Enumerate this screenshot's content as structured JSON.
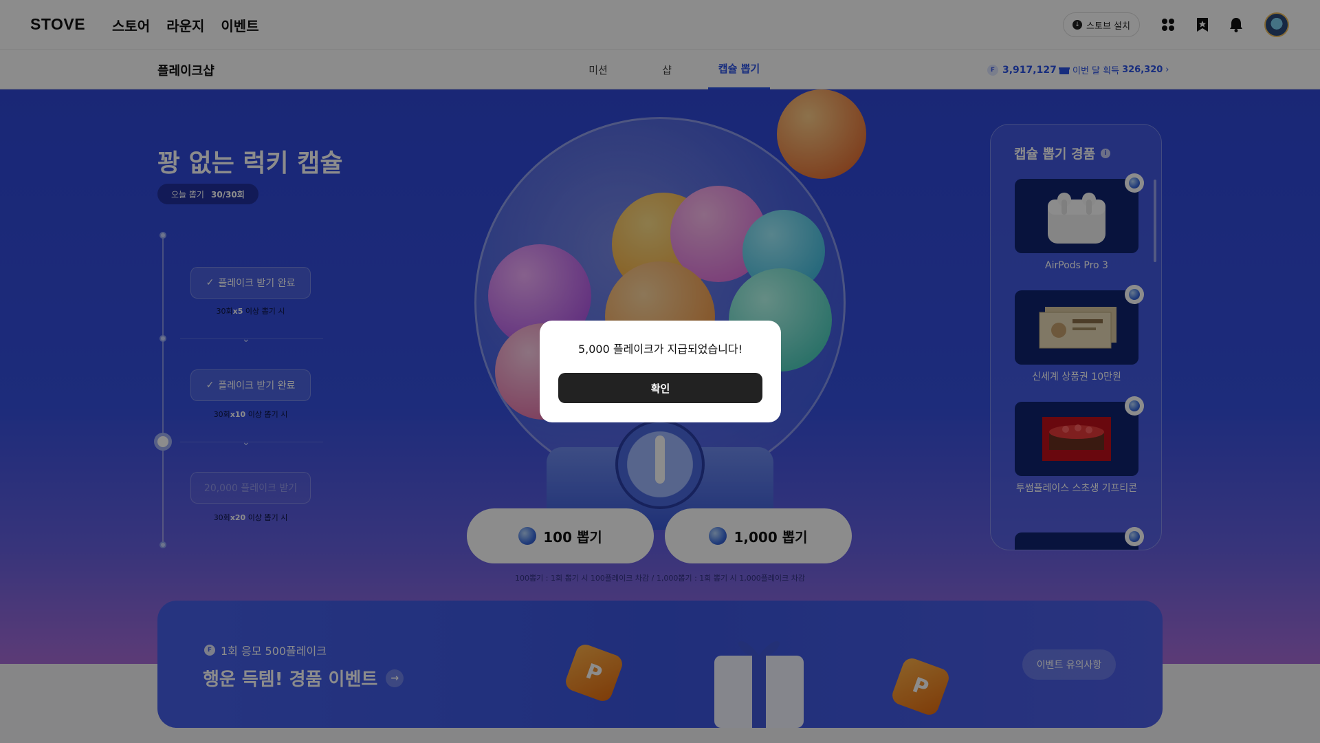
{
  "topnav": {
    "logo": "STOVE",
    "menu": [
      "스토어",
      "라운지",
      "이벤트"
    ],
    "install_label": "스토브 설치",
    "icons": [
      "apps-grid-icon",
      "bookmark-star-icon",
      "bell-icon",
      "avatar"
    ]
  },
  "subnav": {
    "title": "플레이크샵",
    "tabs": [
      "미션",
      "샵",
      "캡슐 뽑기"
    ],
    "active_tab": "캡슐 뽑기",
    "balance": "3,917,127",
    "monthly_label": "이번 달 획득",
    "monthly_value": "326,320"
  },
  "hero": {
    "title": "꽝 없는 럭키 캡슐",
    "today_label": "오늘 뽑기",
    "today_value": "30/30회",
    "steps": [
      {
        "label": "플레이크 받기 완료",
        "cond_a": "30회",
        "cond_x": "x5",
        "cond_b": "이상 뽑기 시"
      },
      {
        "label": "플레이크 받기 완료",
        "cond_a": "30회",
        "cond_x": "x10",
        "cond_b": "이상 뽑기 시"
      },
      {
        "label": "20,000 플레이크 받기",
        "cond_a": "30회",
        "cond_x": "x20",
        "cond_b": "이상 뽑기 시"
      }
    ],
    "draw_buttons": [
      "100 뽑기",
      "1,000 뽑기"
    ],
    "draw_note": "100뽑기 : 1회 뽑기 시 100플레이크 차감 / 1,000뽑기 : 1회 뽑기 시 1,000플레이크 차감"
  },
  "prizes": {
    "title": "캡슐 뽑기 경품",
    "items": [
      "AirPods Pro 3",
      "신세계 상품권 10만원",
      "투썸플레이스 스초생 기프티콘"
    ]
  },
  "event": {
    "sub": "1회 응모 500플레이크",
    "title": "행운 득템! 경품 이벤트",
    "notice": "이벤트 유의사항"
  },
  "modal": {
    "message": "5,000 플레이크가 지급되었습니다!",
    "confirm": "확인"
  },
  "colors": {
    "accent": "#2b52e6",
    "hero_bg": "#3550e0",
    "modal_button": "#222222"
  }
}
